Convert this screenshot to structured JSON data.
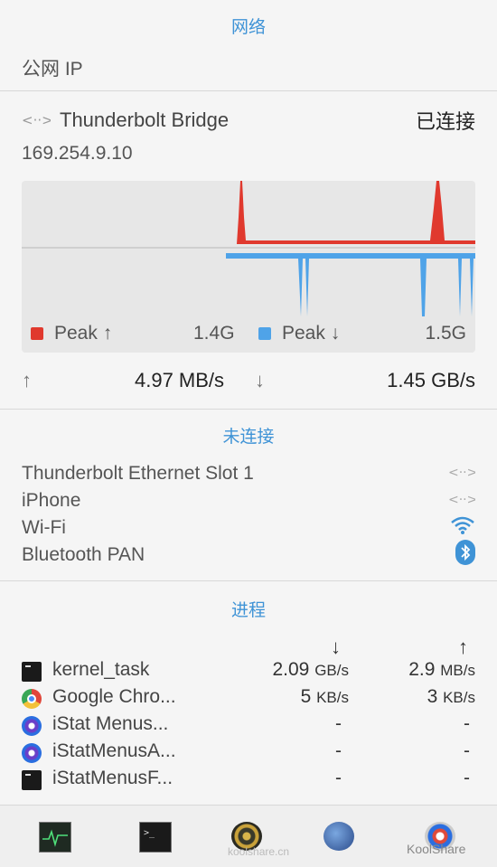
{
  "network": {
    "title": "网络",
    "public_ip_label": "公网 IP"
  },
  "interface": {
    "name": "Thunderbolt Bridge",
    "status": "已连接",
    "ip": "169.254.9.10",
    "legend": {
      "up_label": "Peak ↑",
      "up_value": "1.4G",
      "down_label": "Peak ↓",
      "down_value": "1.5G"
    },
    "speed": {
      "up_arrow": "↑",
      "up_value": "4.97 MB/s",
      "down_arrow": "↓",
      "down_value": "1.45 GB/s"
    },
    "colors": {
      "upload": "#e0392e",
      "download": "#4fa3e8"
    }
  },
  "disconnected": {
    "title": "未连接",
    "items": [
      {
        "name": "Thunderbolt Ethernet Slot 1",
        "icon": "ethernet-icon"
      },
      {
        "name": "iPhone",
        "icon": "ethernet-icon"
      },
      {
        "name": "Wi-Fi",
        "icon": "wifi-icon"
      },
      {
        "name": "Bluetooth PAN",
        "icon": "bluetooth-icon"
      }
    ]
  },
  "processes": {
    "title": "进程",
    "down_arrow": "↓",
    "up_arrow": "↑",
    "rows": [
      {
        "name": "kernel_task",
        "down": "2.09",
        "down_unit": "GB/s",
        "up": "2.9",
        "up_unit": "MB/s",
        "icon": "terminal-icon"
      },
      {
        "name": "Google Chro...",
        "down": "5",
        "down_unit": "KB/s",
        "up": "3",
        "up_unit": "KB/s",
        "icon": "chrome-icon"
      },
      {
        "name": "iStat Menus...",
        "down": "-",
        "down_unit": "",
        "up": "-",
        "up_unit": "",
        "icon": "istat-icon"
      },
      {
        "name": "iStatMenusA...",
        "down": "-",
        "down_unit": "",
        "up": "-",
        "up_unit": "",
        "icon": "istat-icon"
      },
      {
        "name": "iStatMenusF...",
        "down": "-",
        "down_unit": "",
        "up": "-",
        "up_unit": "",
        "icon": "terminal-icon"
      }
    ]
  },
  "watermark": {
    "site": "koolshare.cn",
    "brand": "KoolShare"
  }
}
